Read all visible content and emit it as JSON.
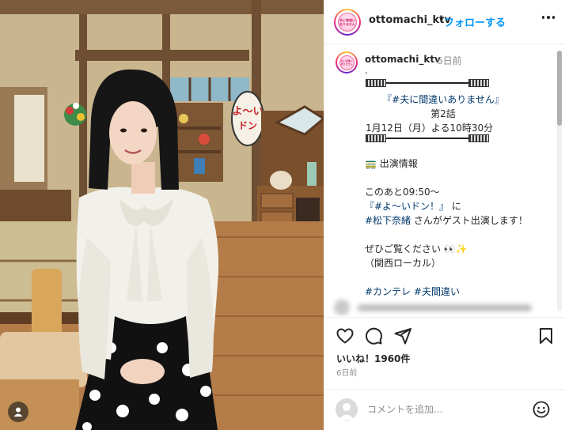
{
  "post": {
    "username": "ottomachi_ktv",
    "follow_separator": "•",
    "follow_label": "フォローする",
    "time_ago": "6日前",
    "logo_text_1": "夫に間違い",
    "logo_text_2": "ありません"
  },
  "caption": {
    "lines": {
      "dot": ".",
      "title": "『#夫に間違いありません』",
      "episode": "第2話",
      "airdate": "1月12日（月）よる10時30分",
      "section_icon": "🚃",
      "section_title": "出演情報",
      "after": "このあと09:50〜",
      "show_tag": "『#よ〜いドン！』",
      "show_suffix": "に",
      "guest_tag": "#松下奈緒",
      "guest_suffix": " さんがゲスト出演します！",
      "cta": "ぜひご覧ください",
      "cta_emoji": "👀✨",
      "region": "（関西ローカル）",
      "tag1": "#カンテレ",
      "tag2": "#夫間違い"
    }
  },
  "stats": {
    "likes_label": "いいね！1960件",
    "date": "6日前"
  },
  "comment": {
    "placeholder": "コメントを追加..."
  },
  "icons": {
    "like": "heart-icon",
    "comment": "comment-icon",
    "share": "send-icon",
    "save": "bookmark-icon",
    "more": "more-icon",
    "emoji": "smile-icon"
  },
  "colors": {
    "link_blue": "#0095f6",
    "hashtag": "#00376b",
    "muted": "#8e8e8e",
    "text": "#262626"
  }
}
